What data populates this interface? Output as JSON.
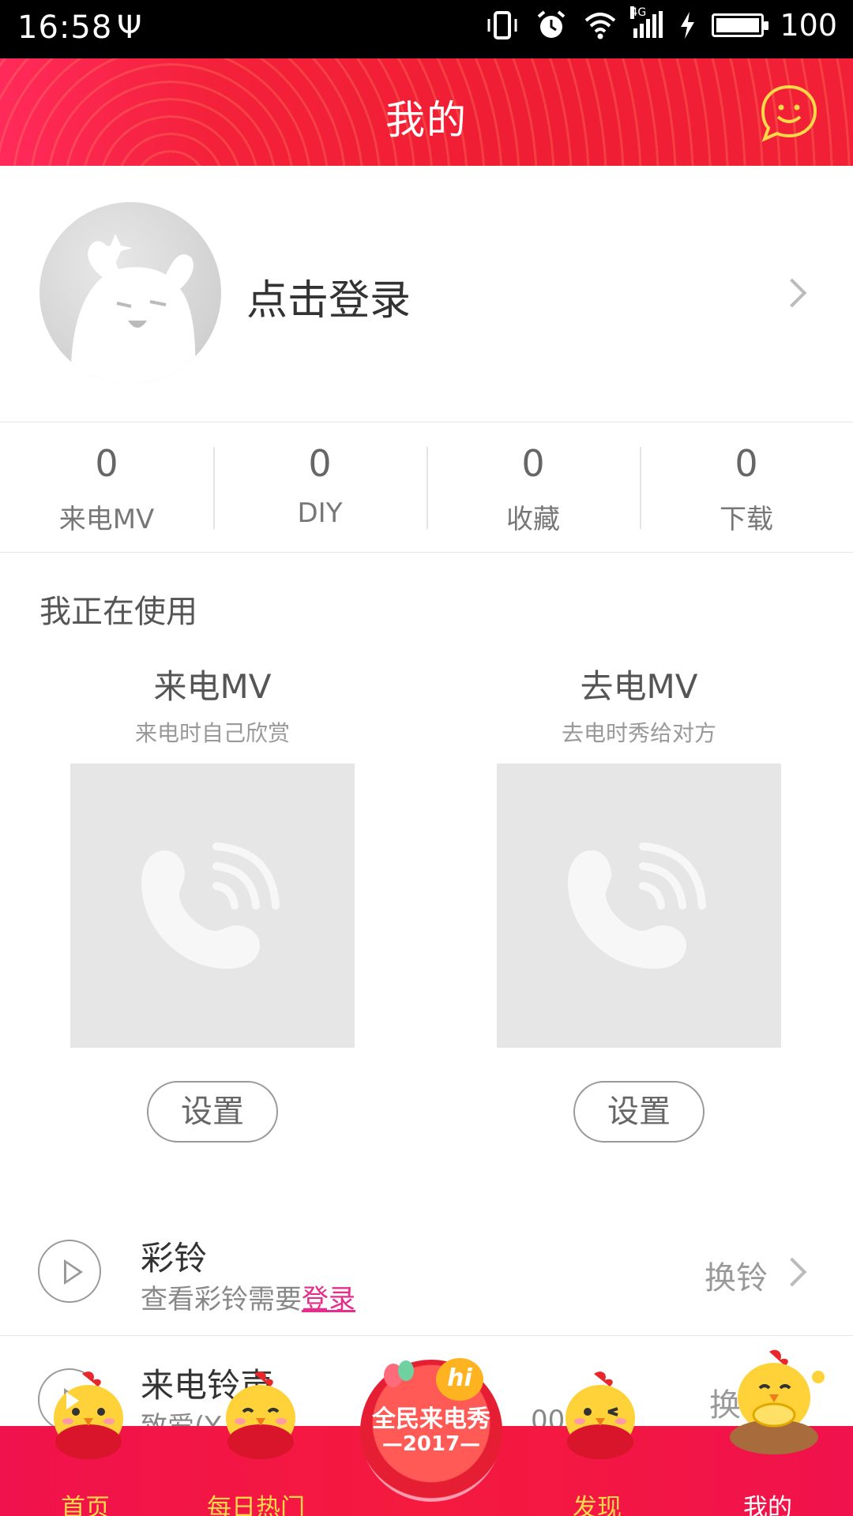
{
  "status_bar": {
    "time": "16:58",
    "usb": "Ψ",
    "network": "4G",
    "battery": "100",
    "battery_level": 1.0
  },
  "header": {
    "title": "我的"
  },
  "profile": {
    "login_prompt": "点击登录"
  },
  "stats": [
    {
      "value": "0",
      "label": "来电MV"
    },
    {
      "value": "0",
      "label": "DIY"
    },
    {
      "value": "0",
      "label": "收藏"
    },
    {
      "value": "0",
      "label": "下载"
    }
  ],
  "using": {
    "title": "我正在使用",
    "cards": [
      {
        "title": "来电MV",
        "subtitle": "来电时自己欣赏",
        "button": "设置"
      },
      {
        "title": "去电MV",
        "subtitle": "去电时秀给对方",
        "button": "设置"
      }
    ]
  },
  "rows": [
    {
      "title": "彩铃",
      "subtitle_prefix": "查看彩铃需要",
      "subtitle_link": "登录",
      "action": "换铃"
    },
    {
      "title": "来电铃声",
      "subtitle": "致爱(Y",
      "subtitle_tail": "0059",
      "action": "换"
    }
  ],
  "badge": {
    "title": "全民来电秀",
    "year": "—2017—",
    "hi": "hi"
  },
  "nav": [
    {
      "label": "首页"
    },
    {
      "label": "每日热门"
    },
    {
      "label": "发现"
    },
    {
      "label": "我的"
    }
  ],
  "colors": {
    "header_red": "#f01e34",
    "nav_red": "#f0124c",
    "nav_text": "#ffd84a",
    "link_pink": "#e52d8a"
  }
}
